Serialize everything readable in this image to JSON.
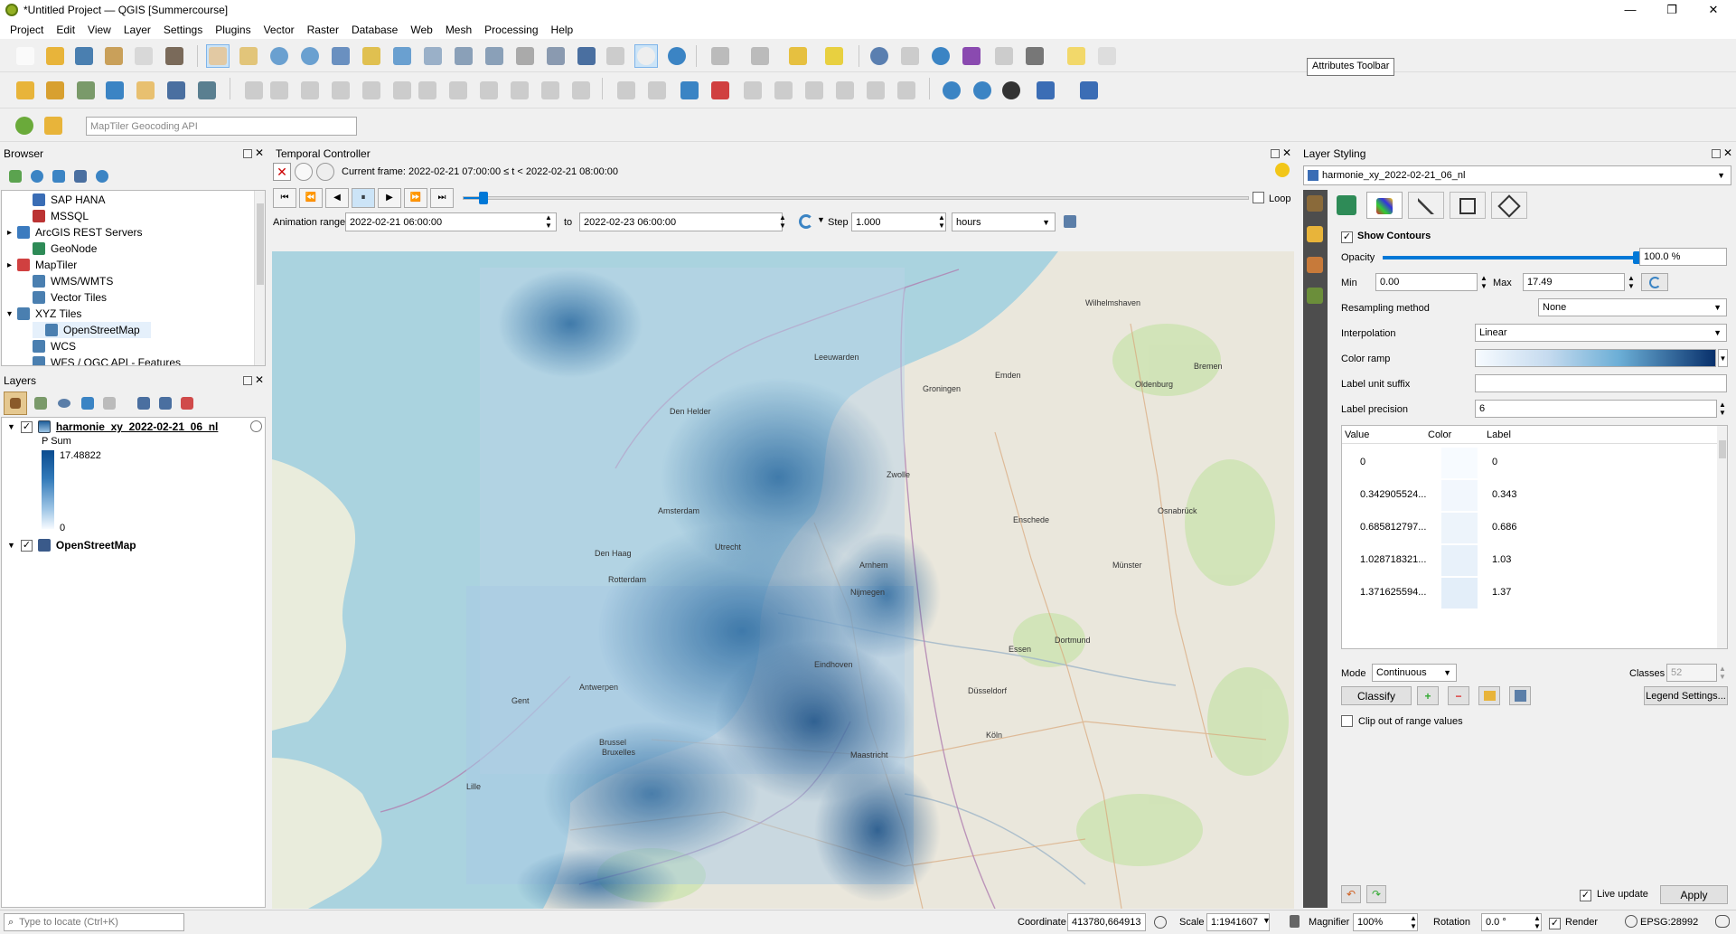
{
  "window": {
    "title": "*Untitled Project — QGIS [Summercourse]"
  },
  "menu": [
    "Project",
    "Edit",
    "View",
    "Layer",
    "Settings",
    "Plugins",
    "Vector",
    "Raster",
    "Database",
    "Web",
    "Mesh",
    "Processing",
    "Help"
  ],
  "tooltip": "Attributes Toolbar",
  "geocoder": {
    "placeholder": "MapTiler Geocoding API"
  },
  "browser": {
    "title": "Browser",
    "items": [
      {
        "label": "SAP HANA",
        "indent": 1,
        "color": "#3a6db5"
      },
      {
        "label": "MSSQL",
        "indent": 1,
        "color": "#b33"
      },
      {
        "label": "ArcGIS REST Servers",
        "indent": 0,
        "color": "#3b7bbf"
      },
      {
        "label": "GeoNode",
        "indent": 1,
        "color": "#2e8b57"
      },
      {
        "label": "MapTiler",
        "indent": 0,
        "color": "#d04040"
      },
      {
        "label": "WMS/WMTS",
        "indent": 1,
        "color": "#4a7fb0"
      },
      {
        "label": "Vector Tiles",
        "indent": 1,
        "color": "#4a7fb0"
      },
      {
        "label": "XYZ Tiles",
        "indent": 0,
        "color": "#4a7fb0"
      },
      {
        "label": "OpenStreetMap",
        "indent": 2,
        "color": "#4a7fb0"
      },
      {
        "label": "WCS",
        "indent": 1,
        "color": "#4a7fb0"
      },
      {
        "label": "WFS / OGC API - Features",
        "indent": 1,
        "color": "#4a7fb0"
      }
    ]
  },
  "layers": {
    "title": "Layers",
    "layer1": {
      "name": "harmonie_xy_2022-02-21_06_nl",
      "legend_title": "P Sum",
      "max": "17.48822",
      "min": "0"
    },
    "layer2": {
      "name": "OpenStreetMap"
    }
  },
  "temporal": {
    "title": "Temporal Controller",
    "current_frame": "Current frame: 2022-02-21 07:00:00 ≤ t < 2022-02-21 08:00:00",
    "loop_label": "Loop",
    "range_label": "Animation range",
    "range_start": "2022-02-21 06:00:00",
    "to_label": "to",
    "range_end": "2022-02-23 06:00:00",
    "step_label": "Step",
    "step_value": "1.000",
    "step_unit": "hours",
    "slider_fraction": 0.02
  },
  "styling": {
    "title": "Layer Styling",
    "layer": "harmonie_xy_2022-02-21_06_nl",
    "show_contours": "Show Contours",
    "opacity_label": "Opacity",
    "opacity_value": "100.0 %",
    "opacity_fraction": 1.0,
    "min_label": "Min",
    "min_value": "0.00",
    "max_label": "Max",
    "max_value": "17.49",
    "resampling_label": "Resampling method",
    "resampling_value": "None",
    "interpolation_label": "Interpolation",
    "interpolation_value": "Linear",
    "color_ramp_label": "Color ramp",
    "label_unit_label": "Label unit suffix",
    "label_unit_value": "",
    "label_precision_label": "Label precision",
    "label_precision_value": "6",
    "table_headers": [
      "Value",
      "Color",
      "Label"
    ],
    "rows": [
      {
        "value": "0",
        "label": "0",
        "color": "#f7fbff"
      },
      {
        "value": "0.342905524...",
        "label": "0.343",
        "color": "#f2f7fd"
      },
      {
        "value": "0.685812797...",
        "label": "0.686",
        "color": "#edf4fb"
      },
      {
        "value": "1.028718321...",
        "label": "1.03",
        "color": "#e8f1fa"
      },
      {
        "value": "1.371625594...",
        "label": "1.37",
        "color": "#e3eef9"
      }
    ],
    "mode_label": "Mode",
    "mode_value": "Continuous",
    "classes_label": "Classes",
    "classes_value": "52",
    "classify_button": "Classify",
    "legend_settings_button": "Legend Settings...",
    "clip_label": "Clip out of range values",
    "live_update_label": "Live update",
    "apply_button": "Apply"
  },
  "statusbar": {
    "locate_placeholder": "Type to locate (Ctrl+K)",
    "coordinate_label": "Coordinate",
    "coordinate_value": "413780,664913",
    "scale_label": "Scale",
    "scale_value": "1:1941607",
    "magnifier_label": "Magnifier",
    "magnifier_value": "100%",
    "rotation_label": "Rotation",
    "rotation_value": "0.0 °",
    "render_label": "Render",
    "crs": "EPSG:28992"
  },
  "map_labels": [
    {
      "text": "Amsterdam",
      "id": "amsterdam"
    },
    {
      "text": "Den Haag",
      "id": "denhaag"
    },
    {
      "text": "Rotterdam",
      "id": "rotterdam"
    },
    {
      "text": "Antwerpen",
      "id": "antwerpen"
    },
    {
      "text": "Brussel",
      "id": "brussel"
    },
    {
      "text": "Bruxelles",
      "id": "bruxelles"
    },
    {
      "text": "Essen",
      "id": "essen"
    },
    {
      "text": "Dortmund",
      "id": "dortmund"
    },
    {
      "text": "Düsseldorf",
      "id": "dusseldorf"
    },
    {
      "text": "Köln",
      "id": "koln"
    },
    {
      "text": "Eindhoven",
      "id": "eindhoven"
    },
    {
      "text": "Groningen",
      "id": "groningen"
    },
    {
      "text": "Emden",
      "id": "emden"
    },
    {
      "text": "Bremen",
      "id": "bremen"
    },
    {
      "text": "Lille",
      "id": "lille"
    },
    {
      "text": "Gent",
      "id": "gent"
    },
    {
      "text": "Utrecht",
      "id": "utrecht"
    },
    {
      "text": "Arnhem",
      "id": "arnhem"
    },
    {
      "text": "Nijmegen",
      "id": "nijmegen"
    },
    {
      "text": "Oldenburg",
      "id": "oldenburg"
    },
    {
      "text": "Münster",
      "id": "munster"
    },
    {
      "text": "Osnabrück",
      "id": "osnabruck"
    },
    {
      "text": "Wilhelmshaven",
      "id": "wilhelmshaven"
    },
    {
      "text": "Den Helder",
      "id": "denhelder"
    },
    {
      "text": "Leeuwarden",
      "id": "leeuwarden"
    },
    {
      "text": "Zwolle",
      "id": "zwolle"
    },
    {
      "text": "Enschede",
      "id": "enschede"
    },
    {
      "text": "Maastricht",
      "id": "maastricht"
    }
  ]
}
